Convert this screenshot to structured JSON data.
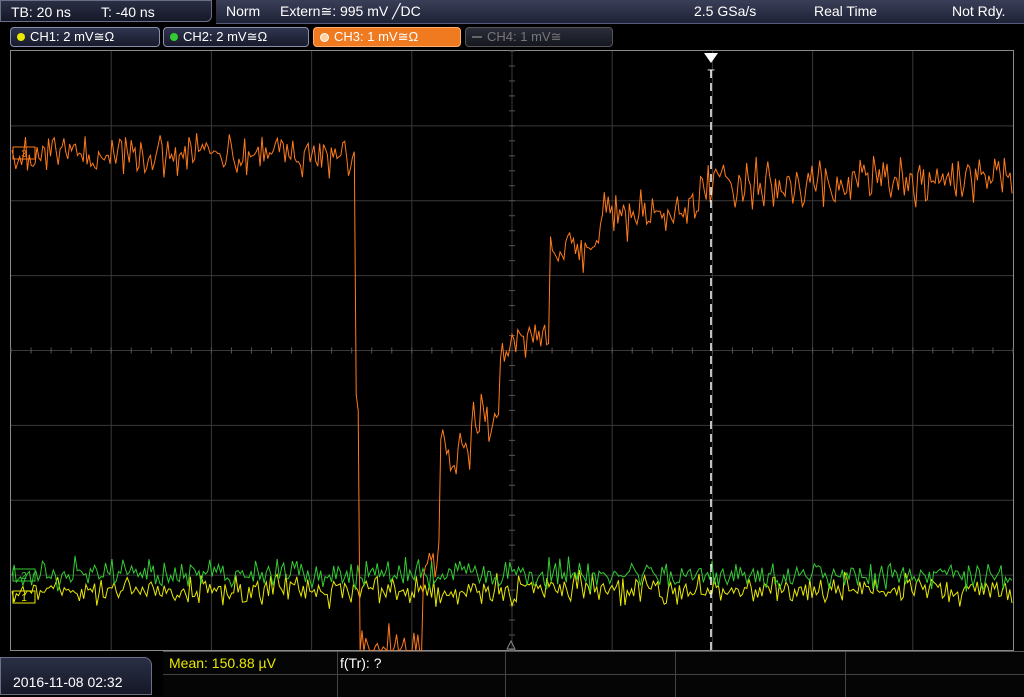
{
  "timebase": {
    "tb": "TB: 20 ns",
    "t": "T: -40 ns"
  },
  "trigger_bar": {
    "mode": "Norm",
    "source": "Extern≅: 995 mV ╱DC",
    "rate": "2.5 GSa/s",
    "acq": "Real Time",
    "status": "Not Rdy."
  },
  "channels": [
    {
      "label": "CH1: 2 mV≅Ω",
      "color": "#e8e800",
      "active": true
    },
    {
      "label": "CH2: 2 mV≅Ω",
      "color": "#33cc33",
      "active": true
    },
    {
      "label": "CH3: 1 mV≅Ω",
      "color": "#ff7a1a",
      "active": true,
      "selected": true
    },
    {
      "label": "CH4: 1 mV≅",
      "color": "#777777",
      "active": false
    }
  ],
  "markers": {
    "ch3": "3",
    "ch2": "2",
    "ch1": "1",
    "trigger": "T"
  },
  "measurement": {
    "mean": "Mean: 150.88 µV",
    "freq": "f(Tr): ?"
  },
  "datetime": "2016-11-08 02:32",
  "colors": {
    "ch1": "#e8e800",
    "ch2": "#33cc33",
    "ch3": "#ff7a1a",
    "grid": "#555555"
  }
}
